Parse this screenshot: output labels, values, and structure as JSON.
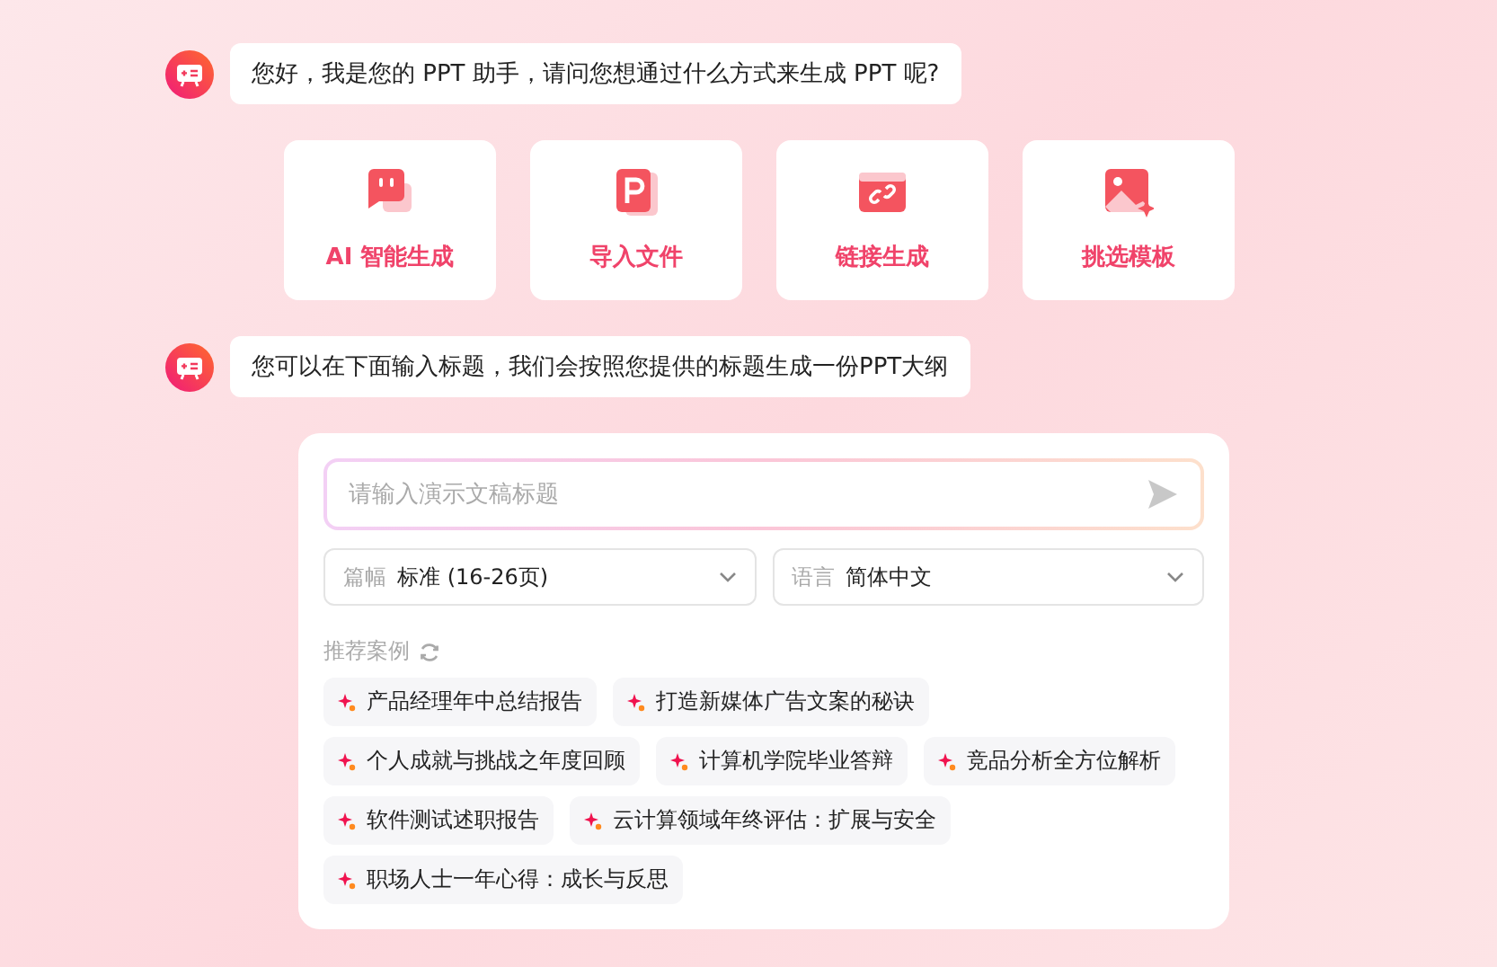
{
  "messages": [
    {
      "text": "您好，我是您的 PPT 助手，请问您想通过什么方式来生成 PPT 呢?"
    },
    {
      "text": "您可以在下面输入标题，我们会按照您提供的标题生成一份PPT大纲"
    }
  ],
  "options": [
    {
      "kind": "chat",
      "label": "AI 智能生成"
    },
    {
      "kind": "file",
      "label": "导入文件"
    },
    {
      "kind": "link",
      "label": "链接生成"
    },
    {
      "kind": "image",
      "label": "挑选模板"
    }
  ],
  "form": {
    "placeholder": "请输入演示文稿标题",
    "selects": [
      {
        "label": "篇幅",
        "value": "标准 (16-26页)"
      },
      {
        "label": "语言",
        "value": "简体中文"
      }
    ],
    "examples_label": "推荐案例",
    "examples": [
      "产品经理年中总结报告",
      "打造新媒体广告文案的秘诀",
      "个人成就与挑战之年度回顾",
      "计算机学院毕业答辩",
      "竞品分析全方位解析",
      "软件测试述职报告",
      "云计算领域年终评估：扩展与安全",
      "职场人士一年心得：成长与反思"
    ]
  }
}
